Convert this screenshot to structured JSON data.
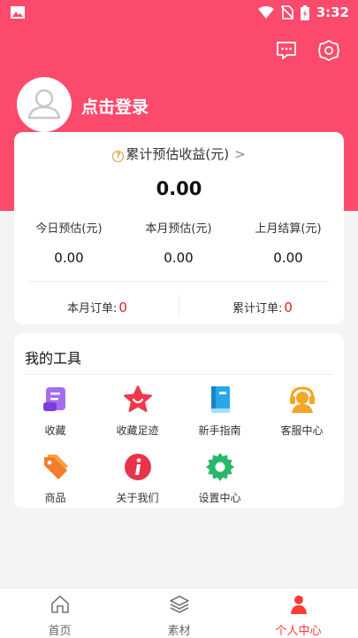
{
  "status_bar": {
    "time": "3:32"
  },
  "header": {
    "login_label": "点击登录",
    "icons": [
      "message-icon",
      "settings-icon"
    ]
  },
  "earnings": {
    "title": "累计预估收益(元)",
    "total": "0.00",
    "stats": [
      {
        "label": "今日预估(元)",
        "value": "0.00"
      },
      {
        "label": "本月预估(元)",
        "value": "0.00"
      },
      {
        "label": "上月结算(元)",
        "value": "0.00"
      }
    ],
    "orders": [
      {
        "label": "本月订单:",
        "value": "0"
      },
      {
        "label": "累计订单:",
        "value": "0"
      }
    ]
  },
  "tools": {
    "title": "我的工具",
    "items": [
      {
        "label": "收藏",
        "icon": "favorites-icon"
      },
      {
        "label": "收藏足迹",
        "icon": "star-icon"
      },
      {
        "label": "新手指南",
        "icon": "book-icon"
      },
      {
        "label": "客服中心",
        "icon": "headset-icon"
      },
      {
        "label": "商品",
        "icon": "tag-icon"
      },
      {
        "label": "关于我们",
        "icon": "info-icon"
      },
      {
        "label": "设置中心",
        "icon": "gear-icon"
      }
    ]
  },
  "tabbar": {
    "tabs": [
      {
        "label": "首页",
        "icon": "home-icon"
      },
      {
        "label": "素材",
        "icon": "layers-icon"
      },
      {
        "label": "个人中心",
        "icon": "person-icon"
      }
    ]
  },
  "colors": {
    "accent": "#fc4a6c",
    "active": "#fc3a3a",
    "order_num": "#e02020"
  }
}
